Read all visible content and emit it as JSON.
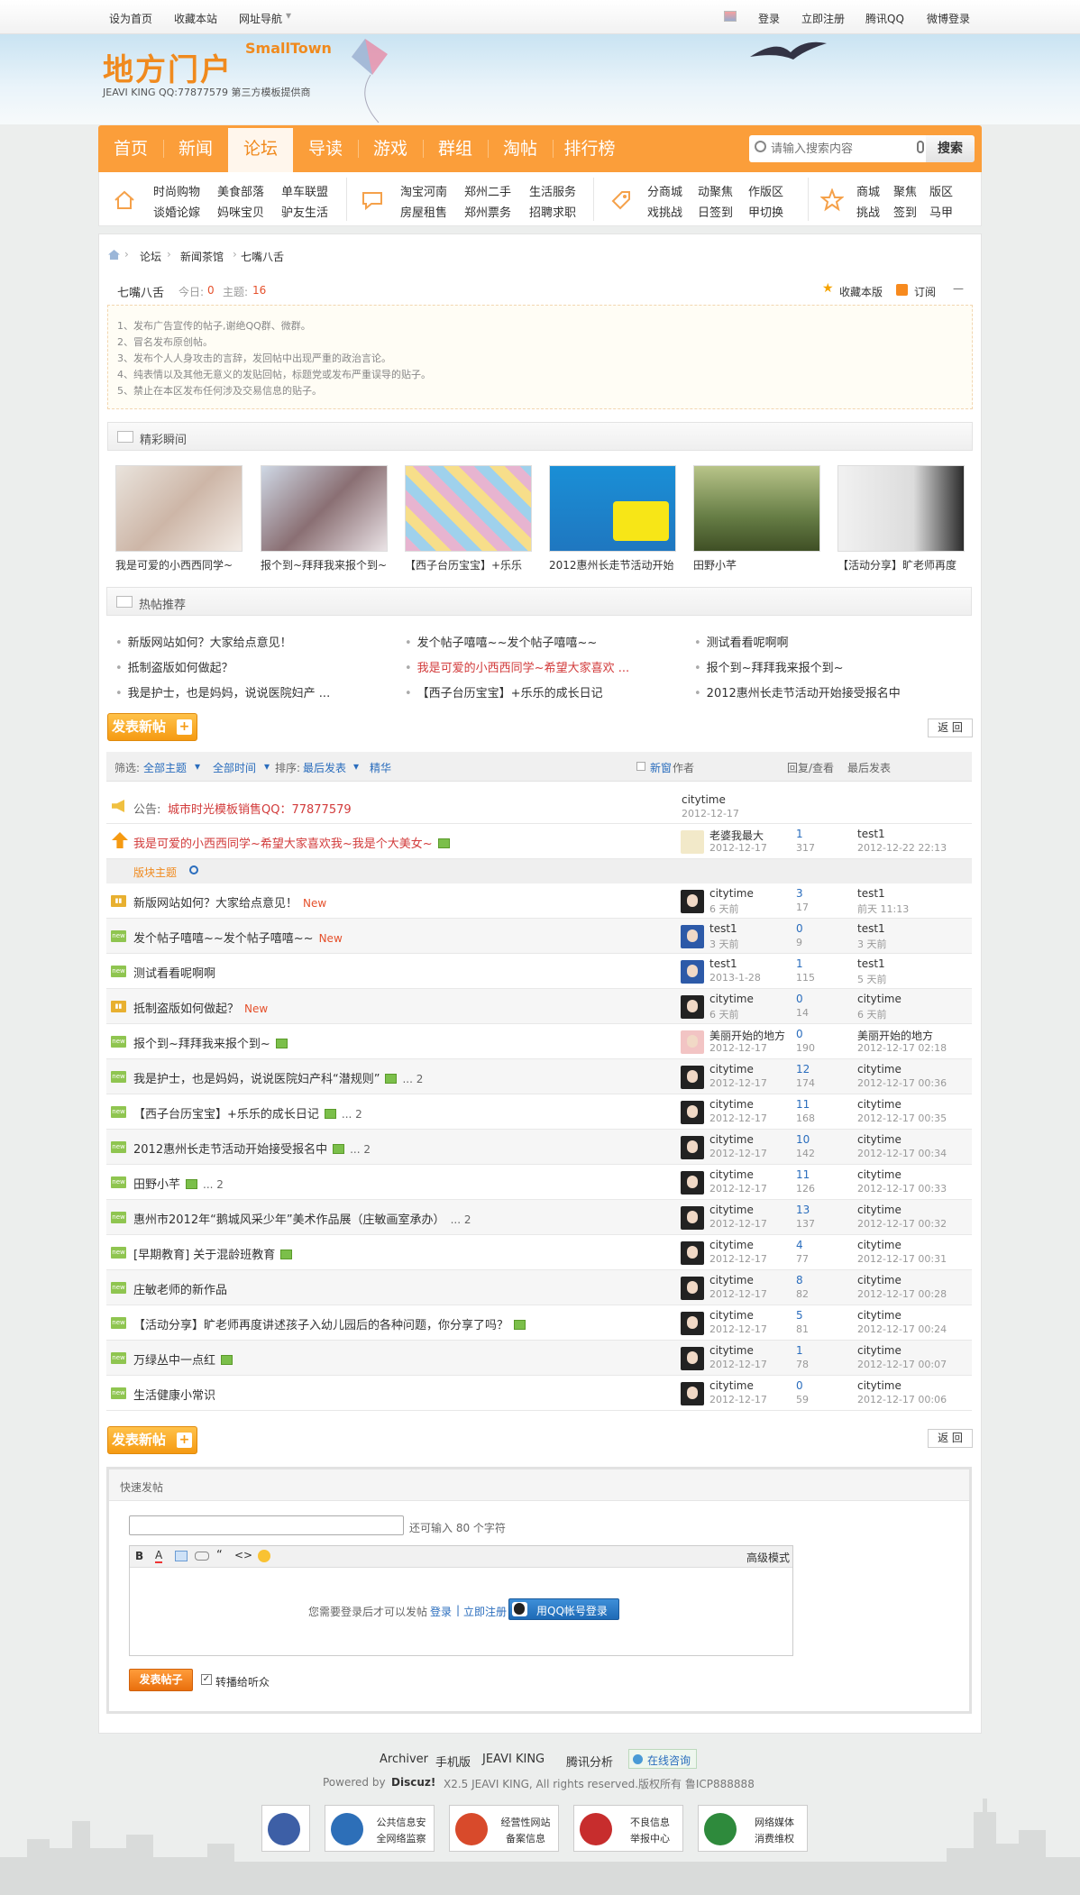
{
  "topbar": {
    "left": [
      "设为首页",
      "收藏本站",
      "网址导航"
    ],
    "right": [
      "登录",
      "立即注册",
      "腾讯QQ",
      "微博登录"
    ]
  },
  "logo": {
    "name": "地方门户",
    "en": "SmallTown",
    "sub": "JEAVI KING QQ:77877579 第三方模板提供商"
  },
  "nav": [
    "首页",
    "新闻",
    "论坛",
    "导读",
    "游戏",
    "群组",
    "淘帖",
    "排行榜"
  ],
  "search": {
    "placeholder": "请输入搜索内容",
    "button": "搜索"
  },
  "subnav": [
    [
      "时尚购物",
      "美食部落",
      "单车联盟",
      "谈婚论嫁",
      "妈咪宝贝",
      "驴友生活"
    ],
    [
      "淘宝河南",
      "郑州二手",
      "生活服务",
      "房屋租售",
      "郑州票务",
      "招聘求职"
    ],
    [
      "分商城",
      "动聚焦",
      "作版区",
      "戏挑战",
      "日签到",
      "甲切换"
    ],
    [
      "商城",
      "聚焦",
      "版区",
      "挑战",
      "签到",
      "马甲"
    ]
  ],
  "breadcrumb": [
    "论坛",
    "新闻茶馆",
    "七嘴八舌"
  ],
  "forum": {
    "name": "七嘴八舌",
    "today_label": "今日:",
    "today": "0",
    "threads_label": "主题:",
    "threads": "16",
    "fav": "收藏本版",
    "sub": "订阅",
    "collapse": "—"
  },
  "rules": [
    "1、发布广告宣传的帖子,谢绝QQ群、微群。",
    "2、冒名发布原创帖。",
    "3、发布个人人身攻击的言辞，发回帖中出现严重的政治言论。",
    "4、纯表情以及其他无意义的发贴回帖，标题党或发布严重误导的贴子。",
    "5、禁止在本区发布任何涉及交易信息的贴子。"
  ],
  "gallery": {
    "title": "精彩瞬间",
    "items": [
      "我是可爱的小西西同学~",
      "报个到~拜拜我来报个到~",
      "【西子台历宝宝】+乐乐",
      "2012惠州长走节活动开始",
      "田野小芊",
      "【活动分享】旷老师再度"
    ]
  },
  "hotpost": {
    "title": "热帖推荐",
    "items": [
      "新版网站如何？大家给点意见！",
      "发个帖子嘻嘻~~发个帖子嘻嘻~~",
      "测试看看呢啊啊",
      "抵制盗版如何做起？",
      "我是可爱的小西西同学~希望大家喜欢 ...",
      "报个到~拜拜我来报个到~",
      "我是护士，也是妈妈，说说医院妇产 ...",
      "【西子台历宝宝】+乐乐的成长日记",
      "2012惠州长走节活动开始接受报名中"
    ]
  },
  "buttons": {
    "new_post": "发表新帖",
    "back": "返 回"
  },
  "filter": {
    "label": "筛选:",
    "all": "全部主题",
    "time": "全部时间",
    "sort_label": "排序:",
    "sort": "最后发表",
    "digest": "精华",
    "newwin": "新窗",
    "author": "作者",
    "reply": "回复/查看",
    "last": "最后发表"
  },
  "announce": {
    "label": "公告:",
    "text": "城市时光模板销售QQ：77877579",
    "author": "citytime",
    "date": "2012-12-17"
  },
  "sticky": {
    "title": "我是可爱的小西西同学~希望大家喜欢我~我是个大美女~",
    "author": "老婆我最大",
    "date": "2012-12-17",
    "replies": "1",
    "views": "317",
    "last_user": "test1",
    "last_date": "2012-12-22 22:13"
  },
  "section_label": "版块主题",
  "threads": [
    {
      "title": "新版网站如何？大家给点意见！",
      "new": "New",
      "attach": false,
      "pages": "",
      "author": "citytime",
      "date": "6 天前",
      "replies": "3",
      "views": "17",
      "last_user": "test1",
      "last_date": "前天 11:13"
    },
    {
      "title": "发个帖子嘻嘻~~发个帖子嘻嘻~~",
      "new": "New",
      "attach": false,
      "pages": "",
      "author": "test1",
      "date": "3 天前",
      "replies": "0",
      "views": "9",
      "last_user": "test1",
      "last_date": "3 天前"
    },
    {
      "title": "测试看看呢啊啊",
      "new": "",
      "attach": false,
      "pages": "",
      "author": "test1",
      "date": "2013-1-28",
      "replies": "1",
      "views": "115",
      "last_user": "test1",
      "last_date": "5 天前"
    },
    {
      "title": "抵制盗版如何做起？",
      "new": "New",
      "attach": false,
      "pages": "",
      "author": "citytime",
      "date": "6 天前",
      "replies": "0",
      "views": "14",
      "last_user": "citytime",
      "last_date": "6 天前"
    },
    {
      "title": "报个到~拜拜我来报个到~",
      "new": "",
      "attach": true,
      "pages": "",
      "author": "美丽开始的地方",
      "date": "2012-12-17",
      "replies": "0",
      "views": "190",
      "last_user": "美丽开始的地方",
      "last_date": "2012-12-17 02:18"
    },
    {
      "title": "我是护士，也是妈妈，说说医院妇产科“潜规则”",
      "new": "",
      "attach": true,
      "pages": "... 2",
      "author": "citytime",
      "date": "2012-12-17",
      "replies": "12",
      "views": "174",
      "last_user": "citytime",
      "last_date": "2012-12-17 00:36"
    },
    {
      "title": "【西子台历宝宝】+乐乐的成长日记",
      "new": "",
      "attach": true,
      "pages": "... 2",
      "author": "citytime",
      "date": "2012-12-17",
      "replies": "11",
      "views": "168",
      "last_user": "citytime",
      "last_date": "2012-12-17 00:35"
    },
    {
      "title": "2012惠州长走节活动开始接受报名中",
      "new": "",
      "attach": true,
      "pages": "... 2",
      "author": "citytime",
      "date": "2012-12-17",
      "replies": "10",
      "views": "142",
      "last_user": "citytime",
      "last_date": "2012-12-17 00:34"
    },
    {
      "title": "田野小芊",
      "new": "",
      "attach": true,
      "pages": "... 2",
      "author": "citytime",
      "date": "2012-12-17",
      "replies": "11",
      "views": "126",
      "last_user": "citytime",
      "last_date": "2012-12-17 00:33"
    },
    {
      "title": "惠州市2012年“鹅城风采少年”美术作品展（庄敏画室承办）",
      "new": "",
      "attach": false,
      "pages": "... 2",
      "author": "citytime",
      "date": "2012-12-17",
      "replies": "13",
      "views": "137",
      "last_user": "citytime",
      "last_date": "2012-12-17 00:32"
    },
    {
      "title": "[早期教育] 关于混龄班教育",
      "new": "",
      "attach": true,
      "pages": "",
      "author": "citytime",
      "date": "2012-12-17",
      "replies": "4",
      "views": "77",
      "last_user": "citytime",
      "last_date": "2012-12-17 00:31"
    },
    {
      "title": "庄敏老师的新作品",
      "new": "",
      "attach": false,
      "pages": "",
      "author": "citytime",
      "date": "2012-12-17",
      "replies": "8",
      "views": "82",
      "last_user": "citytime",
      "last_date": "2012-12-17 00:28"
    },
    {
      "title": "【活动分享】旷老师再度讲述孩子入幼儿园后的各种问题，你分享了吗？",
      "new": "",
      "attach": true,
      "pages": "",
      "author": "citytime",
      "date": "2012-12-17",
      "replies": "5",
      "views": "81",
      "last_user": "citytime",
      "last_date": "2012-12-17 00:24"
    },
    {
      "title": "万绿丛中一点红",
      "new": "",
      "attach": true,
      "pages": "",
      "author": "citytime",
      "date": "2012-12-17",
      "replies": "1",
      "views": "78",
      "last_user": "citytime",
      "last_date": "2012-12-17 00:07"
    },
    {
      "title": "生活健康小常识",
      "new": "",
      "attach": false,
      "pages": "",
      "author": "citytime",
      "date": "2012-12-17",
      "replies": "0",
      "views": "59",
      "last_user": "citytime",
      "last_date": "2012-12-17 00:06"
    }
  ],
  "quickpost": {
    "title": "快速发帖",
    "hint": "还可输入 80 个字符",
    "advanced": "高级模式",
    "login_text": "您需要登录后才可以发帖",
    "login": "登录",
    "register": "立即注册",
    "qq": "用QQ帐号登录",
    "submit": "发表帖子",
    "sync": "转播给听众"
  },
  "footer": {
    "links": [
      "Archiver",
      "手机版",
      "JEAVI KING",
      "腾讯分析"
    ],
    "online": "在线咨询",
    "powered": "Powered by",
    "discuz": "Discuz!",
    "ver": "X2.5 JEAVI KING, All rights reserved.版权所有 鲁ICP888888",
    "badges": [
      [
        "公共信息安",
        "全网络监察"
      ],
      [
        "经营性网站",
        "备案信息"
      ],
      [
        "不良信息",
        "举报中心"
      ],
      [
        "网络媒体",
        "消费维权"
      ]
    ]
  }
}
